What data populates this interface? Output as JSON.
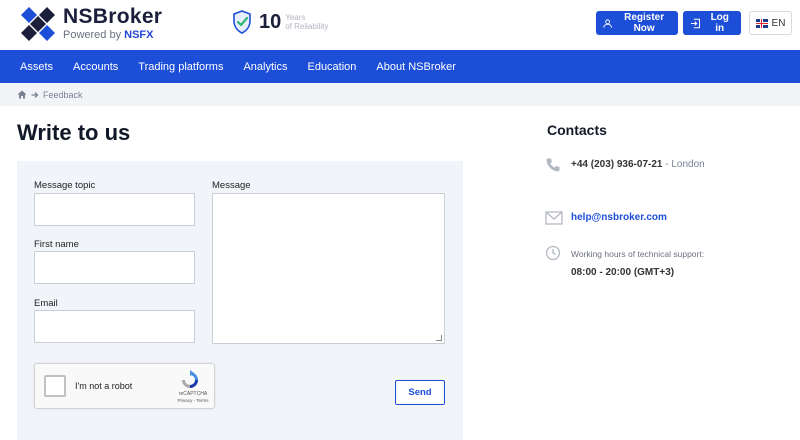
{
  "header": {
    "brand_name": "NSBroker",
    "brand_sub_prefix": "Powered by",
    "brand_sub_highlight": "NSFX",
    "badge_number": "10",
    "badge_line1": "Years",
    "badge_line2": "of Reliability",
    "register_label": "Register Now",
    "login_label": "Log in",
    "language": "EN"
  },
  "nav": {
    "items": [
      "Assets",
      "Accounts",
      "Trading platforms",
      "Analytics",
      "Education",
      "About NSBroker"
    ]
  },
  "breadcrumb": {
    "current": "Feedback"
  },
  "page_title": "Write to us",
  "form": {
    "topic_label": "Message topic",
    "topic_value": "",
    "first_name_label": "First name",
    "first_name_value": "",
    "email_label": "Email",
    "email_value": "",
    "message_label": "Message",
    "message_value": "",
    "captcha_label": "I'm not a robot",
    "captcha_brand": "reCAPTCHA",
    "captcha_terms": "Privacy - Terms",
    "send_label": "Send"
  },
  "contacts": {
    "title": "Contacts",
    "phone": "+44 (203) 936-07-21",
    "phone_suffix": "- London",
    "email": "help@nsbroker.com",
    "hours_label": "Working hours of technical support:",
    "hours_value": "08:00 - 20:00 (GMT+3)"
  },
  "colors": {
    "accent": "#1d4ed8",
    "panel": "#f1f4f9",
    "breadcrumb_bg": "#f2f4f8"
  }
}
